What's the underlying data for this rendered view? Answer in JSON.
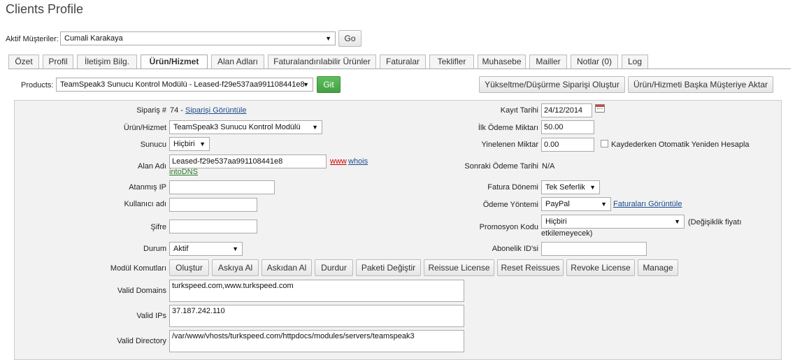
{
  "page": {
    "title": "Clients Profile"
  },
  "client_bar": {
    "label": "Aktif Müşteriler:",
    "selected": "Cumali Karakaya",
    "go_label": "Go"
  },
  "tabs": [
    {
      "label": "Özet"
    },
    {
      "label": "Profil"
    },
    {
      "label": "İletişim Bilg."
    },
    {
      "label": "Ürün/Hizmet"
    },
    {
      "label": "Alan Adları"
    },
    {
      "label": "Faturalandırılabilir Ürünler"
    },
    {
      "label": "Faturalar"
    },
    {
      "label": "Teklifler"
    },
    {
      "label": "Muhasebe"
    },
    {
      "label": "Mailler"
    },
    {
      "label": "Notlar (0)"
    },
    {
      "label": "Log"
    }
  ],
  "products_bar": {
    "label": "Products:",
    "selected": "TeamSpeak3 Sunucu Kontrol Modülü - Leased-f29e537aa991108441e8",
    "git_label": "Git",
    "upgrade_label": "Yükseltme/Düşürme Siparişi Oluştur",
    "transfer_label": "Ürün/Hizmeti Başka Müşteriye Aktar"
  },
  "left": {
    "order_label": "Sipariş #",
    "order_value": "74 - ",
    "order_link": "Siparişi Görüntüle",
    "product_label": "Ürün/Hizmet",
    "product_value": "TeamSpeak3 Sunucu Kontrol Modülü",
    "server_label": "Sunucu",
    "server_value": "Hiçbiri",
    "domain_label": "Alan Adı",
    "domain_value": "Leased-f29e537aa991108441e8",
    "domain_www": "www",
    "domain_whois": "whois",
    "domain_intodns": "intoDNS",
    "ip_label": "Atanmış IP",
    "ip_value": "",
    "user_label": "Kullanıcı adı",
    "user_value": "",
    "pass_label": "Şifre",
    "pass_value": "",
    "status_label": "Durum",
    "status_value": "Aktif"
  },
  "right": {
    "reg_label": "Kayıt Tarihi",
    "reg_value": "24/12/2014",
    "first_label": "İlk Ödeme Miktarı",
    "first_value": "50.00",
    "recurring_label": "Yinelenen Miktar",
    "recurring_value": "0.00",
    "recalc_label": "Kaydederken Otomatik Yeniden Hesapla",
    "next_label": "Sonraki Ödeme Tarihi",
    "next_value": "N/A",
    "cycle_label": "Fatura Dönemi",
    "cycle_value": "Tek Seferlik",
    "payment_label": "Ödeme Yöntemi",
    "payment_value": "PayPal",
    "payment_link": "Faturaları Görüntüle",
    "promo_label": "Promosyon Kodu",
    "promo_value": "Hiçbiri",
    "promo_note_1": "(Değişiklik fiyatı",
    "promo_note_2": "etkilemeyecek)",
    "sub_label": "Abonelik ID'si",
    "sub_value": ""
  },
  "module": {
    "label": "Modül Komutları",
    "buttons": [
      "Oluştur",
      "Askıya Al",
      "Askıdan Al",
      "Durdur",
      "Paketi Değiştir",
      "Reissue License",
      "Reset Reissues",
      "Revoke License",
      "Manage"
    ]
  },
  "custom": {
    "domains_label": "Valid Domains",
    "domains_value": "turkspeed.com,www.turkspeed.com",
    "ips_label": "Valid IPs",
    "ips_value": "37.187.242.110",
    "dir_label": "Valid Directory",
    "dir_value": "/var/www/vhosts/turkspeed.com/httpdocs/modules/servers/teamspeak3"
  }
}
